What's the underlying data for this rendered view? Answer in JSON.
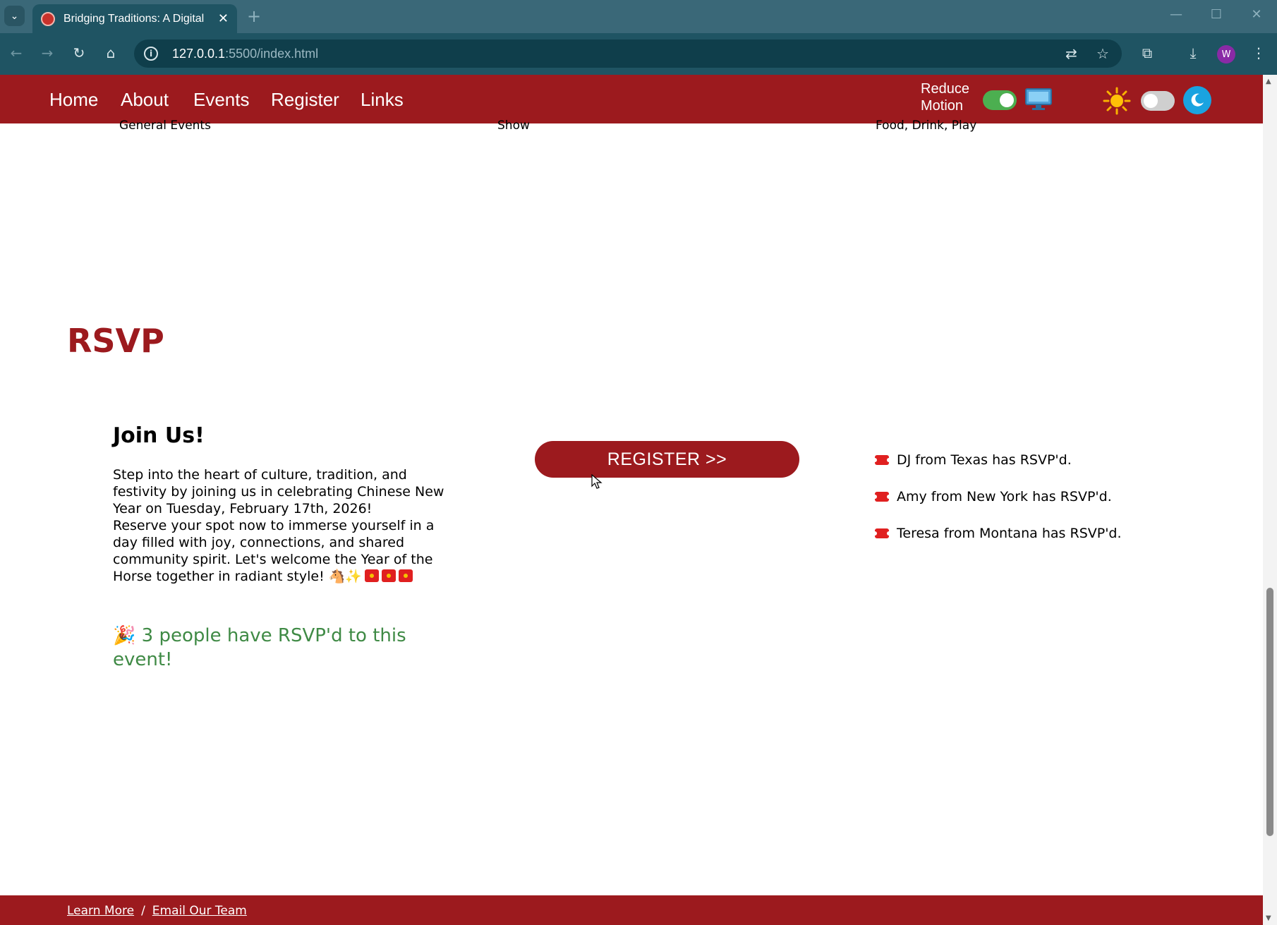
{
  "browser": {
    "tab_title": "Bridging Traditions: A Digital",
    "url_host": "127.0.0.1",
    "url_rest": ":5500/index.html",
    "profile_initial": "W"
  },
  "nav": {
    "links": [
      "Home",
      "About",
      "Events",
      "Register",
      "Links"
    ],
    "reduce_motion_label": "Reduce Motion"
  },
  "events_captions": [
    "General Events",
    "Show",
    "Food, Drink, Play"
  ],
  "rsvp": {
    "heading": "RSVP",
    "join_title": "Join Us!",
    "join_text_1": "Step into the heart of culture, tradition, and festivity by joining us in celebrating Chinese New Year on Tuesday, February 17th, 2026!",
    "join_text_2": "Reserve your spot now to immerse yourself in a day filled with joy, connections, and shared community spirit. Let's welcome the Year of the Horse together in radiant style!",
    "join_emoji": "🐴✨",
    "count_emoji": "🎉",
    "count_text": "3 people have RSVP'd to this event!",
    "register_button": "REGISTER >>",
    "attendees": [
      "DJ from Texas has RSVP'd.",
      "Amy from New York has RSVP'd.",
      "Teresa from Montana has RSVP'd."
    ]
  },
  "footer": {
    "learn_more": "Learn More",
    "separator": "/",
    "email_team": "Email Our Team"
  },
  "colors": {
    "brand_red": "#9c1a1e",
    "success_green": "#3f8a45",
    "toggle_on": "#4caf50",
    "chrome_teal": "#1f5463"
  },
  "state": {
    "reduce_motion_enabled": true,
    "dark_mode_enabled": false
  }
}
